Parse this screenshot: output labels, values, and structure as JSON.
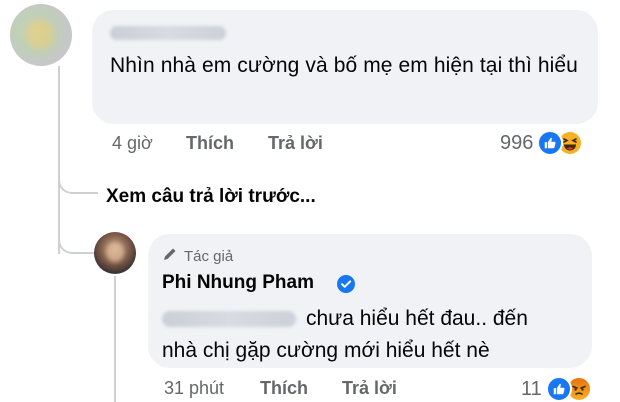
{
  "top_comment": {
    "text": "Nhìn nhà em cường và bố mẹ em hiện tại thì hiểu",
    "time": "4 giờ",
    "like_label": "Thích",
    "reply_label": "Trả lời",
    "reaction_count": "996",
    "reaction_icons": [
      "like-icon",
      "haha-icon"
    ]
  },
  "see_previous_replies": "Xem câu trả lời trước...",
  "reply_comment": {
    "author_badge": "Tác giả",
    "author_badge_icon": "pencil-icon",
    "author_name": "Phi Nhung Pham",
    "verified_icon": "verified-badge-icon",
    "text_line1": "chưa hiểu hết đau.. đến",
    "text_line2": "nhà chị gặp cường mới hiểu hết nè",
    "time": "31 phút",
    "like_label": "Thích",
    "reply_label": "Trả lời",
    "reaction_count": "11",
    "reaction_icons": [
      "like-icon",
      "angry-icon"
    ]
  },
  "colors": {
    "bubble": "#f0f2f5",
    "meta_text": "#65676b",
    "primary_text": "#050505",
    "like_blue": "#1877f2",
    "thread_line": "#ced0d4"
  }
}
